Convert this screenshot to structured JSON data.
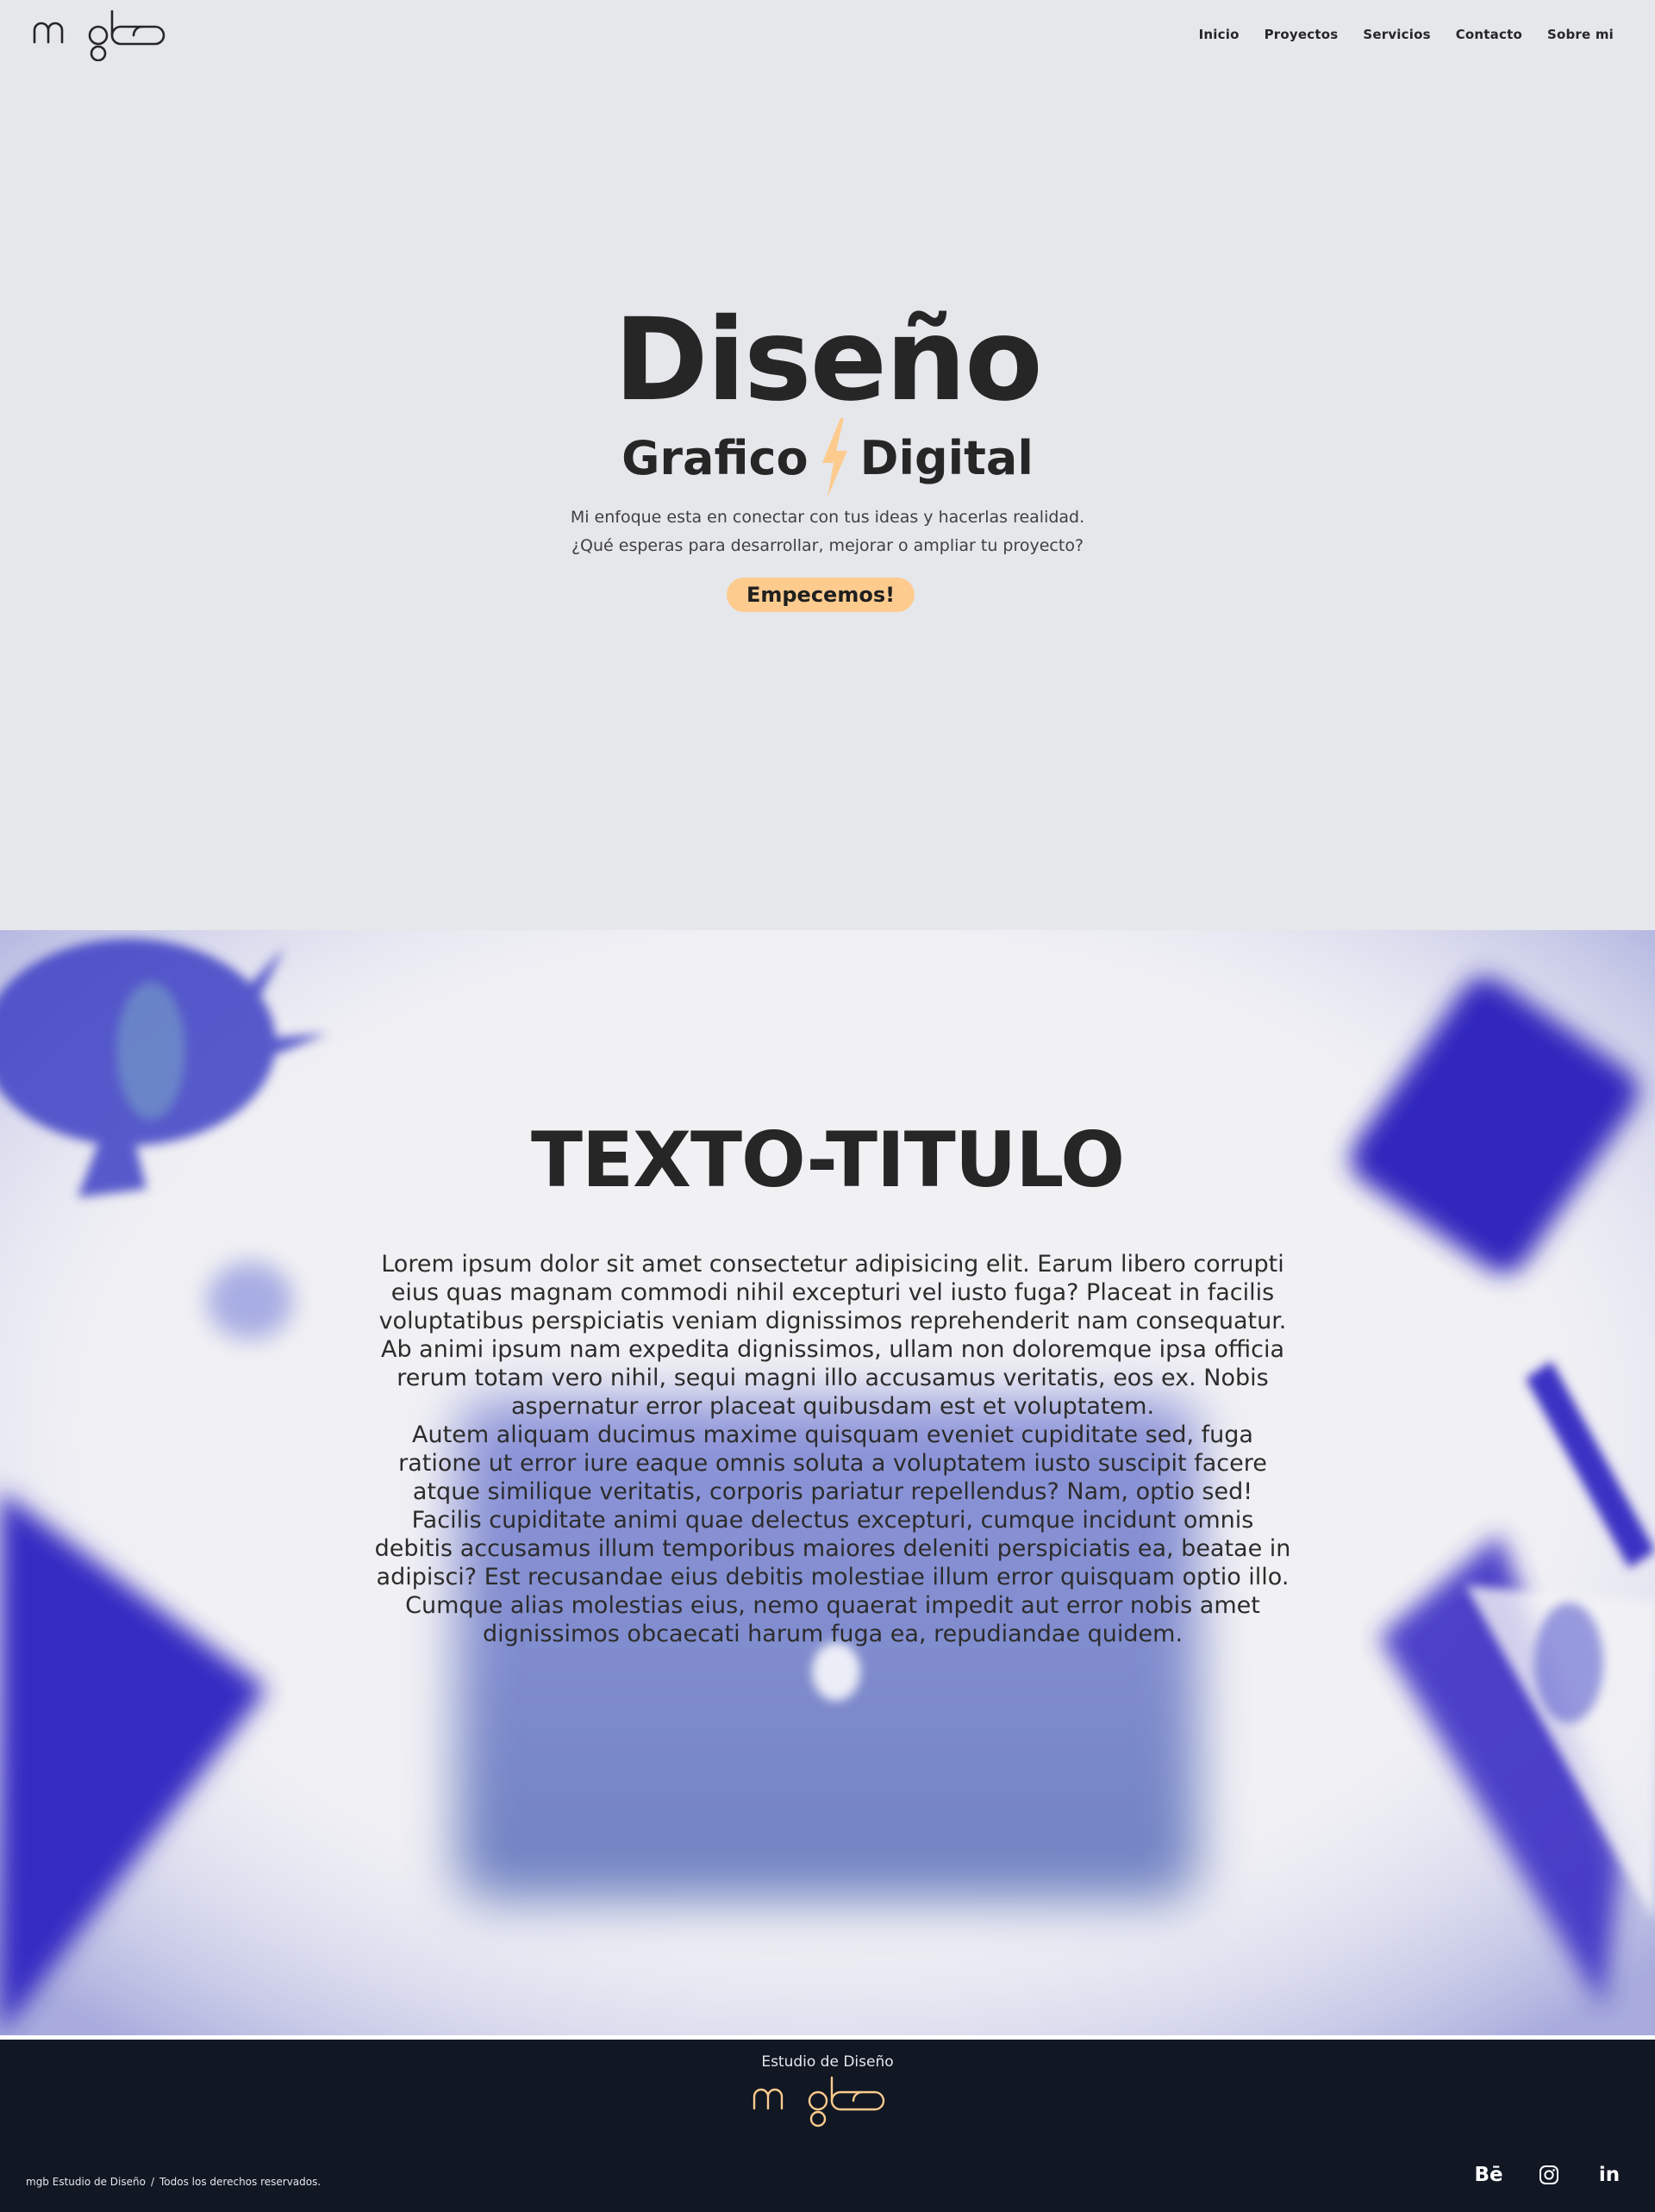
{
  "header": {
    "logo_text": "mgb",
    "nav": [
      {
        "label": "Inicio"
      },
      {
        "label": "Proyectos"
      },
      {
        "label": "Servicios"
      },
      {
        "label": "Contacto"
      },
      {
        "label": "Sobre mi"
      }
    ]
  },
  "hero": {
    "title": "Diseño",
    "subtitle_left": "Grafico",
    "subtitle_right": "Digital",
    "text_line1": "Mi enfoque esta en conectar con tus ideas y hacerlas realidad.",
    "text_line2": "¿Qué esperas para desarrollar, mejorar o ampliar tu proyecto?",
    "cta_label": "Empecemos!"
  },
  "feature": {
    "title": "TEXTO-TITULO",
    "paragraphs": [
      "Lorem ipsum dolor sit amet consectetur adipisicing elit. Earum libero corrupti eius quas magnam commodi nihil excepturi vel iusto fuga? Placeat in facilis voluptatibus perspiciatis veniam dignissimos reprehenderit nam consequatur. Ab animi ipsum nam expedita dignissimos, ullam non doloremque ipsa officia rerum totam vero nihil, sequi magni illo accusamus veritatis, eos ex. Nobis aspernatur error placeat quibusdam est et voluptatem.",
      "Autem aliquam ducimus maxime quisquam eveniet cupiditate sed, fuga ratione ut error iure eaque omnis soluta a voluptatem iusto suscipit facere atque similique veritatis, corporis pariatur repellendus? Nam, optio sed!",
      "Facilis cupiditate animi quae delectus excepturi, cumque incidunt omnis debitis accusamus illum temporibus maiores deleniti perspiciatis ea, beatae in adipisci? Est recusandae eius debitis molestiae illum error quisquam optio illo. Cumque alias molestias eius, nemo quaerat impedit aut error nobis amet dignissimos obcaecati harum fuga ea, repudiandae quidem."
    ]
  },
  "footer": {
    "tagline": "Estudio de Diseño",
    "copyright_left": "mgb Estudio de Diseño",
    "copyright_sep": "/",
    "copyright_right": "Todos los derechos reservados.",
    "socials": [
      {
        "label": "Bē",
        "icon": "behance-icon"
      },
      {
        "label": "",
        "icon": "instagram-icon"
      },
      {
        "label": "in",
        "icon": "linkedin-icon"
      }
    ]
  },
  "colors": {
    "background": "#e5e7eb",
    "accent": "#fdcb8e",
    "footer_bg": "#111723",
    "text": "#262626",
    "image_blue": "#3a2fc4"
  }
}
